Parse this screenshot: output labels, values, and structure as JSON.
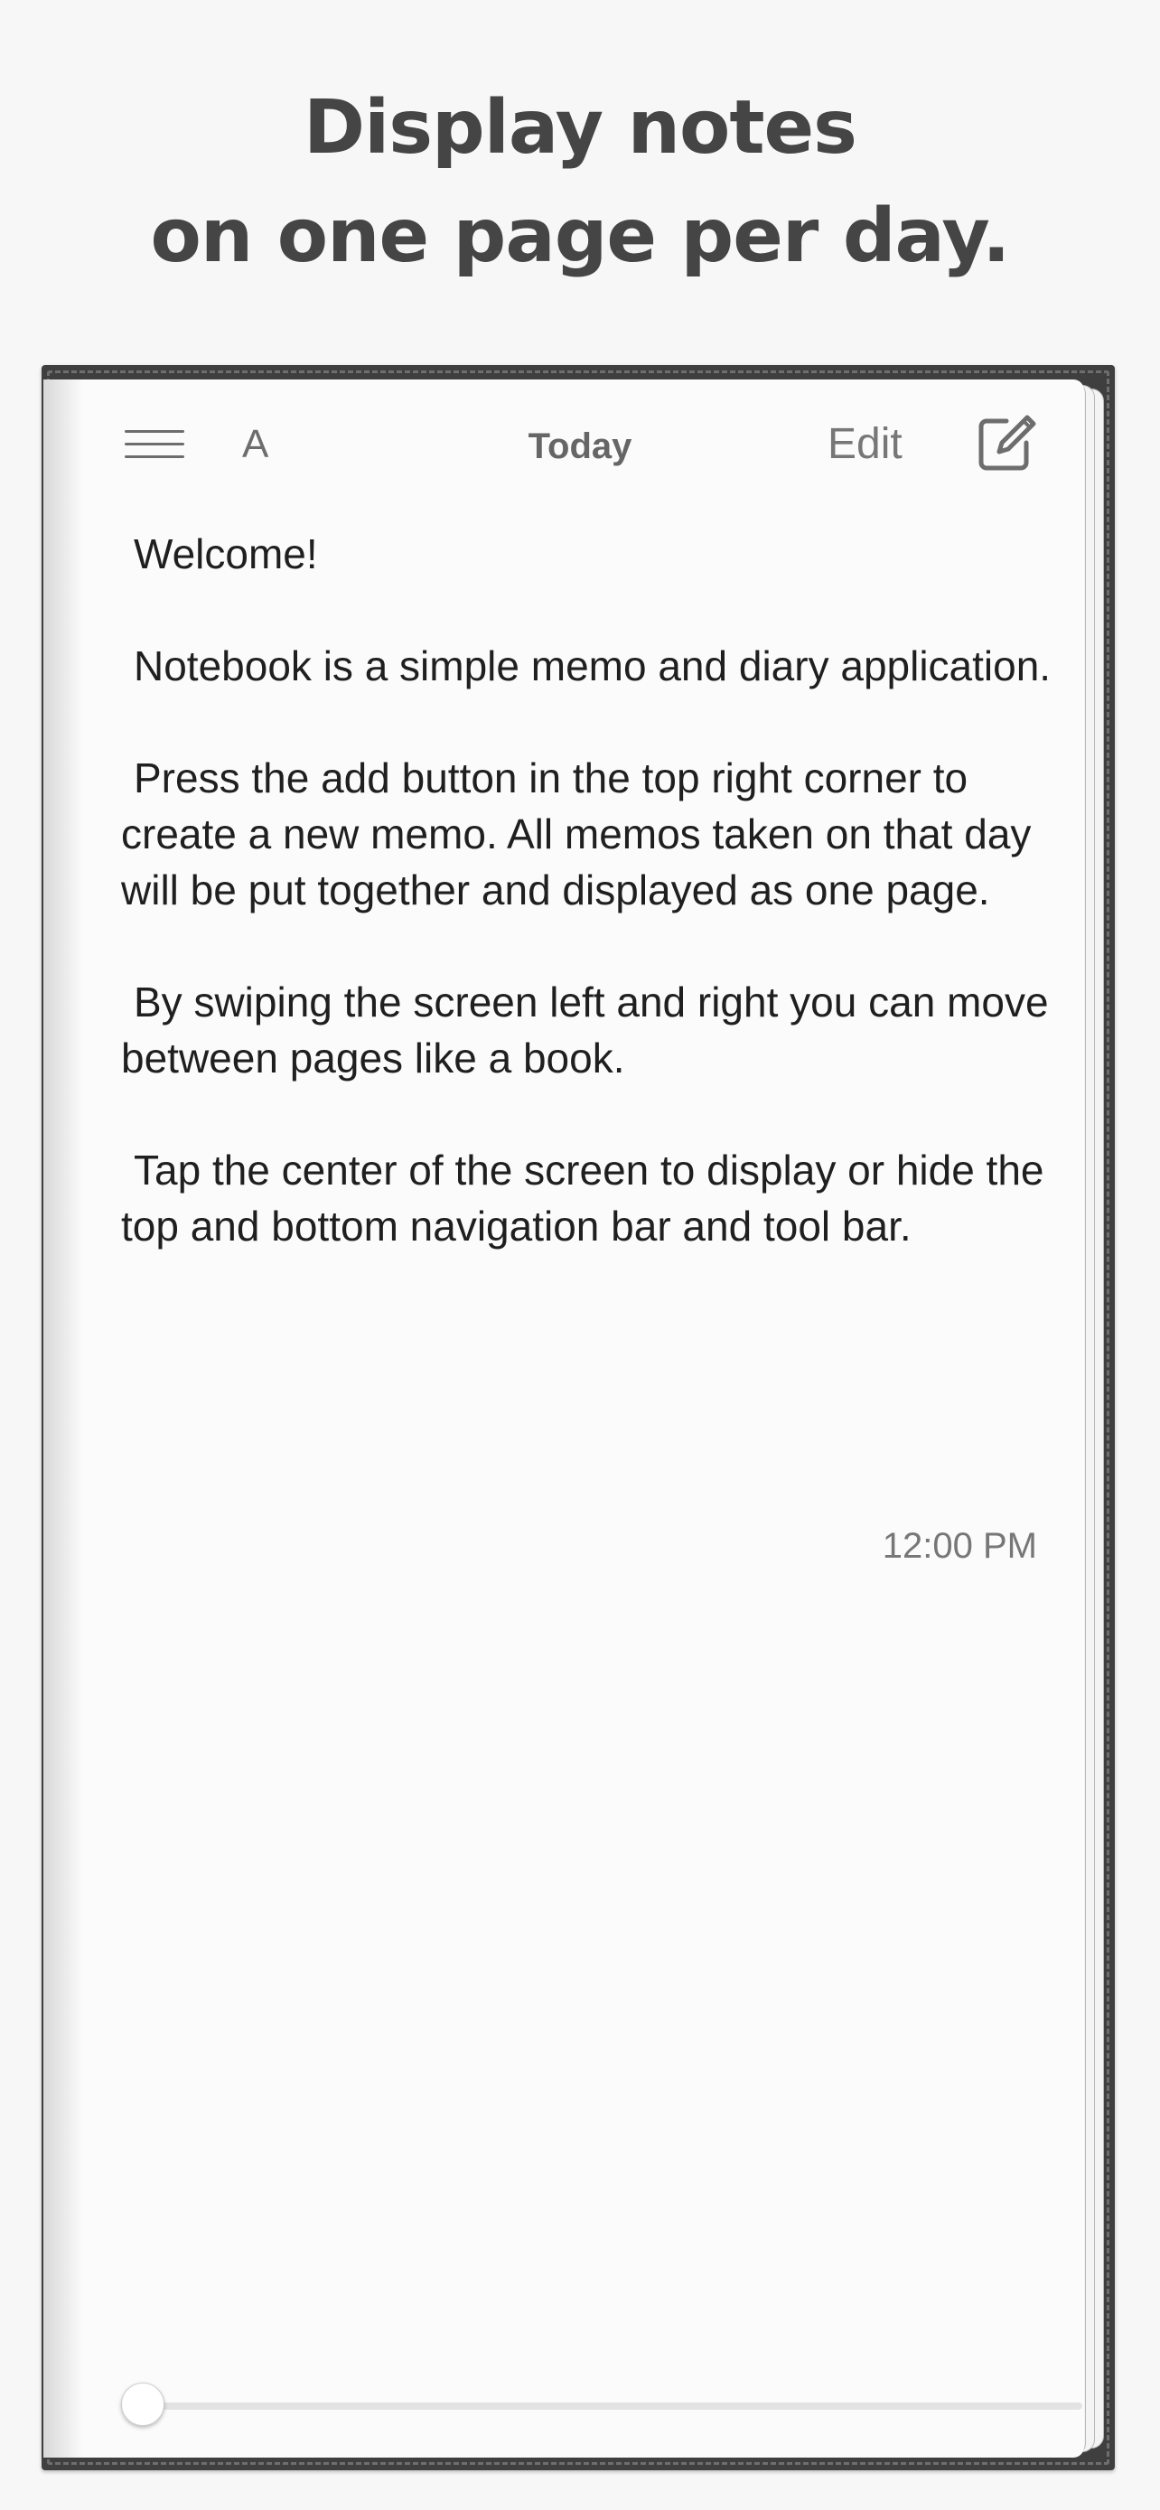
{
  "headline": {
    "line1": "Display notes",
    "line2": "on one page per day."
  },
  "nav": {
    "menu_icon": "hamburger-menu-icon",
    "font_button": "A",
    "title": "Today",
    "edit_label": "Edit",
    "compose_icon": "compose-note-icon"
  },
  "memo": {
    "paragraphs": [
      "Welcome!",
      "Notebook is a simple memo and diary application.",
      "Press the add button in the top right corner to create a new memo. All memos taken on that day will be put together and displayed as one page.",
      "By swiping the screen left and right you can move between pages like a book.",
      "Tap the center of the screen to display or hide the top and bottom navigation bar and tool bar."
    ],
    "time": "12:00 PM"
  },
  "page_slider": {
    "value": 0
  },
  "colors": {
    "background": "#f7f7f7",
    "page": "#fbfbfb",
    "frame": "#3f3f3f",
    "text": "#1f1f1f",
    "secondary_text": "#777777"
  }
}
